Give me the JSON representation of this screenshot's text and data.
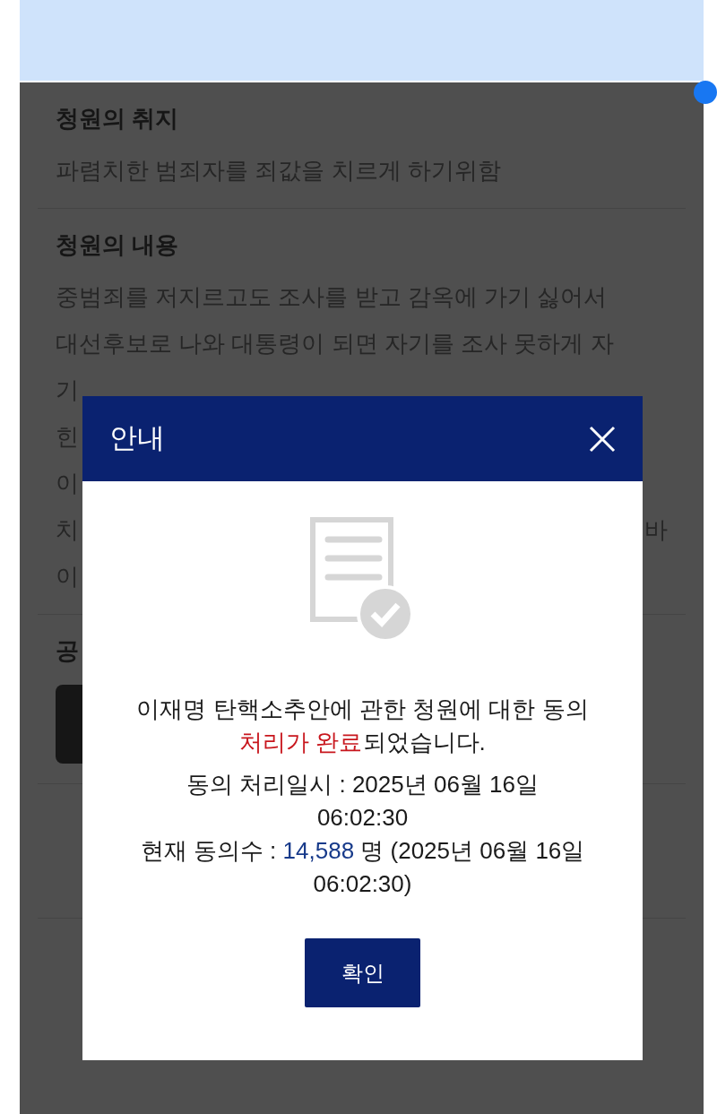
{
  "sections": [
    {
      "kind": "text",
      "heading": "청원의 취지",
      "lines": [
        {
          "left": "파렴치한 범죄자를 죄값을 치르게 하기위함"
        }
      ]
    },
    {
      "kind": "text",
      "heading": "청원의 내용",
      "lines": [
        {
          "left": "중범죄를 저지르고도 조사를 받고 감옥에 가기 싫어서"
        },
        {
          "left": "대선후보로 나와 대통령이 되면  자기를 조사 못하게 자"
        },
        {
          "left": "기"
        },
        {
          "left": "힌"
        },
        {
          "left": "이"
        },
        {
          "left": "치",
          "right": "바"
        },
        {
          "left": "이"
        }
      ]
    },
    {
      "kind": "share",
      "heading": "공"
    },
    {
      "kind": "empty"
    }
  ],
  "dialog": {
    "title": "안내",
    "message": {
      "before": "이재명 탄핵소추안에 관한 청원에 대한 동의",
      "highlight": "처리가 완료",
      "after": "되었습니다."
    },
    "processed_at": "동의 처리일시 : 2025년 06월 16일 06:02:30",
    "count": {
      "label": "현재 동의수 : ",
      "value": "14,588",
      "after": " 명 (2025년 06월 16일 06:02:30)"
    },
    "button": "확인"
  }
}
